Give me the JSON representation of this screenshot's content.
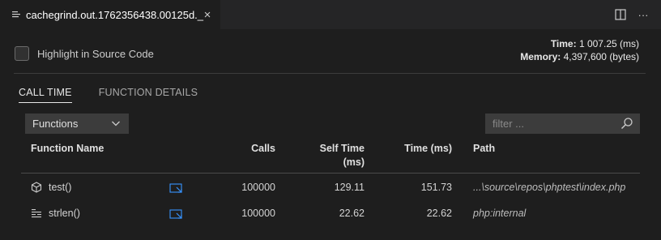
{
  "tab": {
    "title": "cachegrind.out.1762356438.00125d._",
    "close_glyph": "×",
    "file_icon": "lines-icon"
  },
  "editor_actions": [
    {
      "icon": "split-editor-icon"
    },
    {
      "icon": "more-actions-icon",
      "glyph": "···"
    }
  ],
  "highlight": {
    "label": "Highlight in Source Code",
    "checked": false
  },
  "stats": {
    "time_label": "Time:",
    "time_value": "1 007.25 (ms)",
    "memory_label": "Memory:",
    "memory_value": "4,397,600 (bytes)"
  },
  "subtabs": [
    {
      "label": "CALL TIME",
      "active": true
    },
    {
      "label": "FUNCTION DETAILS",
      "active": false
    }
  ],
  "dropdown": {
    "selected": "Functions"
  },
  "filter": {
    "placeholder": "filter ...",
    "value": ""
  },
  "table": {
    "headers": {
      "function_name": "Function Name",
      "calls": "Calls",
      "self_time_1": "Self Time",
      "self_time_2": "(ms)",
      "time": "Time (ms)",
      "path": "Path"
    },
    "rows": [
      {
        "icon": "cube-icon",
        "name": "test()",
        "calls": "100000",
        "self_time": "129.11",
        "time": "151.73",
        "path": "...\\source\\repos\\phptest\\index.php"
      },
      {
        "icon": "string-icon",
        "name": "strlen()",
        "calls": "100000",
        "self_time": "22.62",
        "time": "22.62",
        "path": "php:internal"
      }
    ]
  },
  "colors": {
    "background": "#1e1e1e",
    "tabbar": "#252526",
    "accent_link": "#3794ff"
  }
}
